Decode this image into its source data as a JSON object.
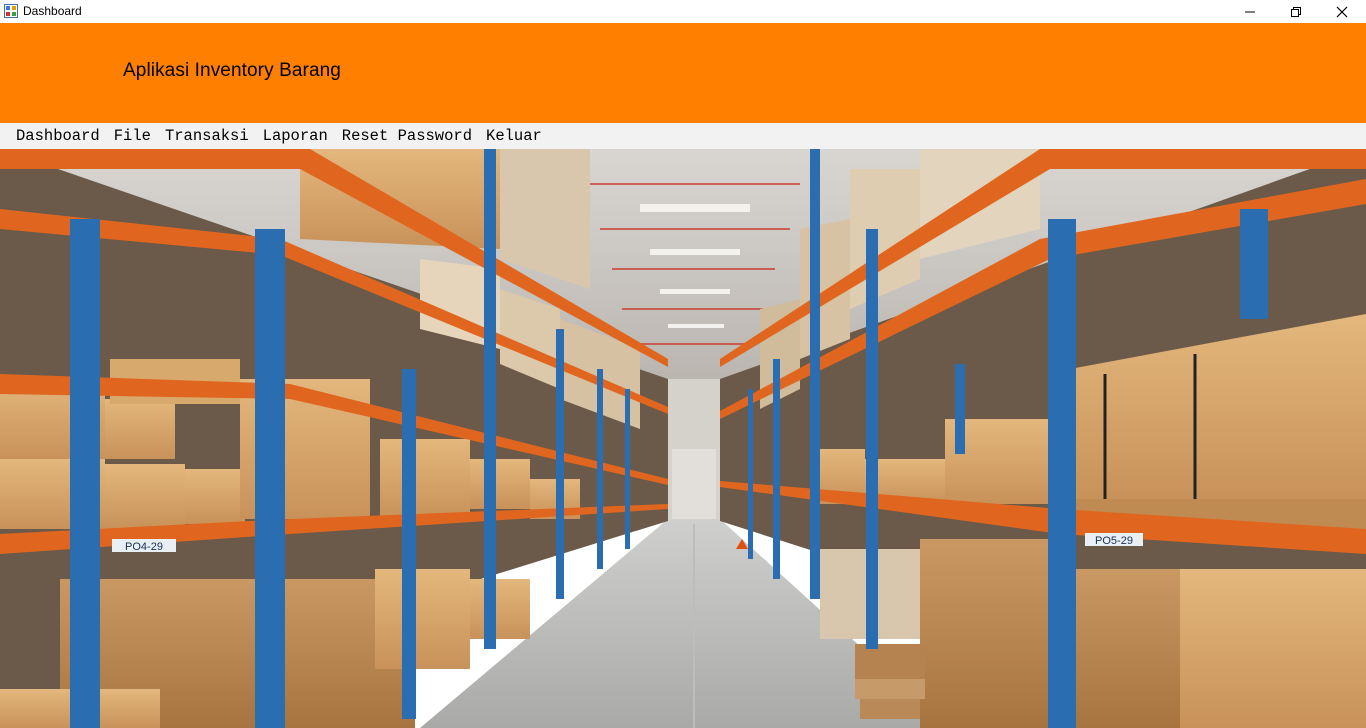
{
  "window": {
    "title": "Dashboard"
  },
  "header": {
    "app_title": "Aplikasi Inventory Barang",
    "color": "#ff8000"
  },
  "menu": {
    "items": [
      "Dashboard",
      "File",
      "Transaksi",
      "Laporan",
      "Reset Password",
      "Keluar"
    ]
  },
  "background_image": {
    "rack_labels": [
      "PO4-29",
      "PO5-29"
    ]
  },
  "icons": [
    "app-icon",
    "minimize-icon",
    "restore-icon",
    "close-icon"
  ]
}
